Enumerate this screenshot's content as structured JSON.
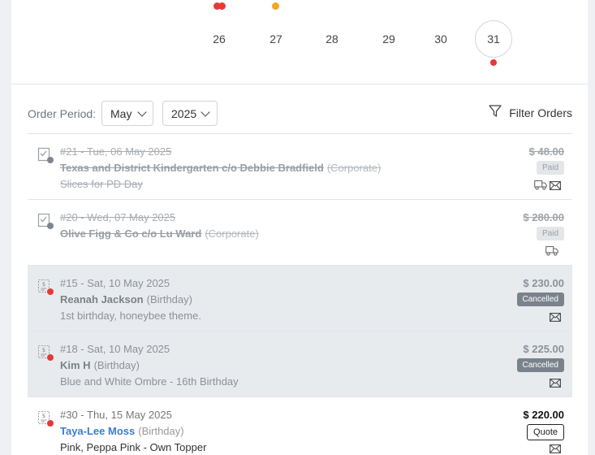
{
  "calendar": {
    "days": [
      "26",
      "27",
      "28",
      "29",
      "30",
      "31"
    ],
    "selected_day": "31",
    "event_colors": {
      "red": "#e53935",
      "orange": "#f5a623",
      "blue": "#3a7bd5"
    }
  },
  "toolbar": {
    "order_period_label": "Order Period:",
    "month": "May",
    "year": "2025",
    "filter_label": "Filter Orders"
  },
  "orders": [
    {
      "header": "#21 - Tue, 06 May 2025",
      "customer": "Texas and District Kindergarten c/o Debbie Bradfield",
      "type": "(Corporate)",
      "note": "Slices for PD Day",
      "price": "$ 48.00",
      "status": "Paid",
      "icon": "checklist-icon",
      "dot": "#7d8590",
      "delivery": true,
      "email": true
    },
    {
      "header": "#20 - Wed, 07 May 2025",
      "customer": "Olive Figg & Co c/o Lu Ward",
      "type": "(Corporate)",
      "note": "",
      "price": "$ 280.00",
      "status": "Paid",
      "icon": "checklist-icon",
      "dot": "#7d8590",
      "delivery": true,
      "email": false
    },
    {
      "header": "#15 - Sat, 10 May 2025",
      "customer": "Reanah Jackson",
      "type": "(Birthday)",
      "note": "1st birthday, honeybee theme.",
      "price": "$ 230.00",
      "status": "Cancelled",
      "icon": "invoice-icon",
      "dot": "#e53935",
      "delivery": false,
      "email": true
    },
    {
      "header": "#18 - Sat, 10 May 2025",
      "customer": "Kim H",
      "type": "(Birthday)",
      "note": "Blue and White Ombre - 16th Birthday",
      "price": "$ 225.00",
      "status": "Cancelled",
      "icon": "invoice-icon",
      "dot": "#e53935",
      "delivery": false,
      "email": true
    },
    {
      "header": "#30 - Thu, 15 May 2025",
      "customer": "Taya-Lee Moss",
      "type": "(Birthday)",
      "note": "Pink, Peppa Pink - Own Topper",
      "price": "$ 220.00",
      "status": "Quote",
      "icon": "invoice-icon",
      "dot": "#e53935",
      "delivery": false,
      "email": true
    }
  ]
}
